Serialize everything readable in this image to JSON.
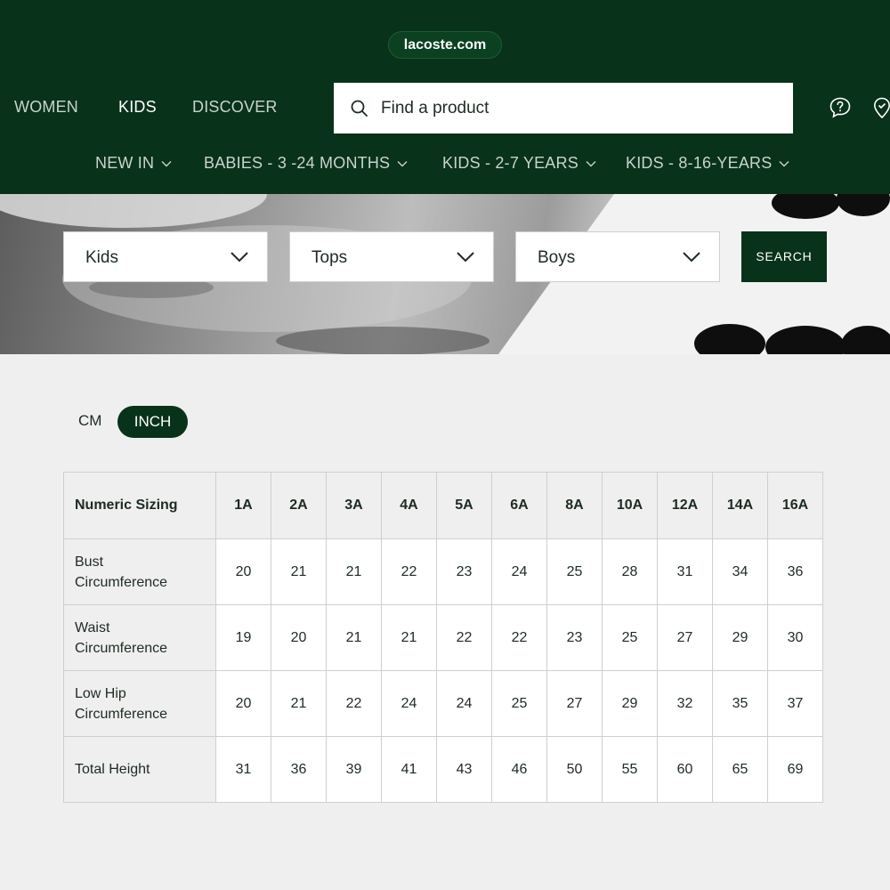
{
  "header": {
    "url": "lacoste.com",
    "nav": [
      "WOMEN",
      "KIDS",
      "DISCOVER"
    ],
    "active_nav": "KIDS",
    "search_placeholder": "Find a product",
    "icons": [
      "help-icon",
      "store-locator-icon"
    ],
    "sub_nav": [
      "NEW IN",
      "BABIES - 3 -24 MONTHS",
      "KIDS - 2-7 YEARS",
      "KIDS - 8-16-YEARS"
    ]
  },
  "filters": {
    "selects": [
      "Kids",
      "Tops",
      "Boys"
    ],
    "search_button": "SEARCH"
  },
  "units": {
    "cm": "CM",
    "inch": "INCH",
    "selected": "INCH"
  },
  "size_table": {
    "header_label": "Numeric Sizing",
    "sizes": [
      "1A",
      "2A",
      "3A",
      "4A",
      "5A",
      "6A",
      "8A",
      "10A",
      "12A",
      "14A",
      "16A"
    ],
    "rows": [
      {
        "label_line1": "Bust",
        "label_line2": "Circumference",
        "values": [
          "20",
          "21",
          "21",
          "22",
          "23",
          "24",
          "25",
          "28",
          "31",
          "34",
          "36"
        ]
      },
      {
        "label_line1": "Waist",
        "label_line2": "Circumference",
        "values": [
          "19",
          "20",
          "21",
          "21",
          "22",
          "22",
          "23",
          "25",
          "27",
          "29",
          "30"
        ]
      },
      {
        "label_line1": "Low Hip",
        "label_line2": "Circumference",
        "values": [
          "20",
          "21",
          "22",
          "24",
          "24",
          "25",
          "27",
          "29",
          "32",
          "35",
          "37"
        ]
      },
      {
        "label_line1": "Total Height",
        "label_line2": "",
        "values": [
          "31",
          "36",
          "39",
          "41",
          "43",
          "46",
          "50",
          "55",
          "60",
          "65",
          "69"
        ]
      }
    ]
  },
  "colors": {
    "brand_green": "#083219",
    "background": "#efefef"
  }
}
